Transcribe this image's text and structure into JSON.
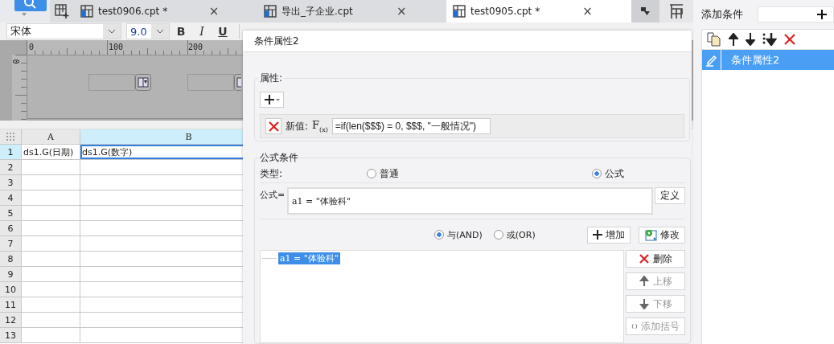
{
  "tab_bar": {
    "tabs": [
      {
        "label": "test0906.cpt *",
        "selected": false,
        "close": "×"
      },
      {
        "label": "导出_子企业.cpt",
        "selected": false,
        "close": "×"
      },
      {
        "label": "test0905.cpt *",
        "selected": true,
        "close": "×"
      }
    ]
  },
  "toolbar": {
    "font": "宋体",
    "size": "9.0",
    "style_buttons": [
      {
        "label": "B",
        "kind": "bold"
      },
      {
        "label": "I",
        "kind": "italic"
      },
      {
        "label": "U",
        "kind": "underline"
      }
    ]
  },
  "ruler": {
    "ticks": [
      "0",
      "100",
      "200"
    ],
    "vertical_tick": "0"
  },
  "sheet": {
    "columns": [
      {
        "label": "A",
        "selected": false
      },
      {
        "label": "B",
        "selected": true
      }
    ],
    "rows": [
      {
        "label": "1",
        "selected": true,
        "cells": [
          {
            "text": "ds1.G(日期)",
            "selected": false
          },
          {
            "text": "ds1.G(数字)",
            "selected": true
          }
        ]
      },
      {
        "label": "2",
        "selected": false
      },
      {
        "label": "3",
        "selected": false
      },
      {
        "label": "4",
        "selected": false
      },
      {
        "label": "5",
        "selected": false
      },
      {
        "label": "6",
        "selected": false
      },
      {
        "label": "7",
        "selected": false
      },
      {
        "label": "8",
        "selected": false
      },
      {
        "label": "9",
        "selected": false
      },
      {
        "label": "10",
        "selected": false
      },
      {
        "label": "11",
        "selected": false
      },
      {
        "label": "12",
        "selected": false
      },
      {
        "label": "13",
        "selected": false
      }
    ]
  },
  "dialog": {
    "title": "条件属性2",
    "properties": {
      "legend": "属性:",
      "field_label": "新值:",
      "formula_button": "F$_{(x)}$",
      "value": "=if(len($$$) = 0, $$$, \"一般情况\")"
    },
    "formula_condition": {
      "legend": "公式条件",
      "type_label": "类型:",
      "types": [
        {
          "label": "普通",
          "selected": false
        },
        {
          "label": "公式",
          "selected": true
        }
      ],
      "formula_label": "公式=",
      "formula": "a1 = \"体验科\"",
      "define_button": "定义",
      "logic": [
        {
          "label": "与(AND)",
          "selected": true
        },
        {
          "label": "或(OR)",
          "selected": false
        }
      ],
      "add_button": "增加",
      "modify_button": "修改",
      "conditions": [
        {
          "text": "a1 = \"体验科\"",
          "selected": true
        }
      ],
      "side_buttons": [
        {
          "label": "删除",
          "kind": "delete",
          "disabled": false
        },
        {
          "label": "上移",
          "kind": "up",
          "disabled": true
        },
        {
          "label": "下移",
          "kind": "down",
          "disabled": true
        },
        {
          "label": "添加括号",
          "kind": "bracket",
          "disabled": true
        }
      ]
    }
  },
  "right_panel": {
    "add_label": "添加条件",
    "items": [
      {
        "label": "条件属性2",
        "selected": true
      }
    ]
  }
}
